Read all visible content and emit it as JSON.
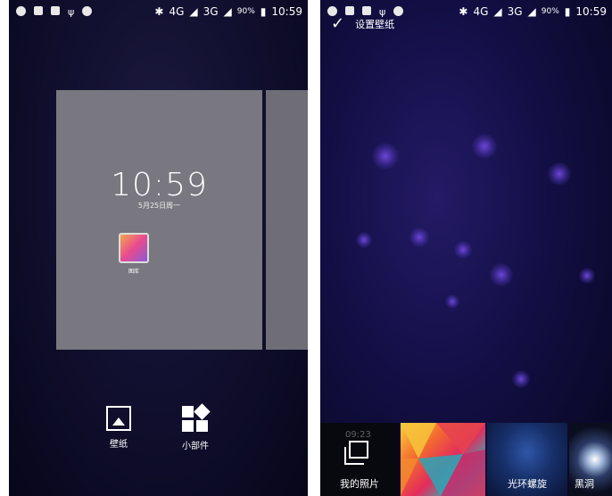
{
  "left_screen": {
    "status": {
      "network": "4G",
      "network2": "3G",
      "battery": "90%",
      "time": "10:59"
    },
    "home_preview": {
      "clock": "10:59",
      "date": "5月25日周一",
      "app_label": "图库"
    },
    "buttons": {
      "wallpaper": "壁纸",
      "widgets": "小部件"
    }
  },
  "right_screen": {
    "status": {
      "network": "4G",
      "network2": "3G",
      "battery": "90%",
      "time": "10:59"
    },
    "title": "设置壁纸",
    "thumbnails": [
      {
        "label": "我的照片"
      },
      {
        "label": ""
      },
      {
        "label": "光环螺旋"
      },
      {
        "label": "黑洞"
      }
    ],
    "faded_time": "09:23"
  },
  "colors": {
    "page_card": "#79777f",
    "background_dark": "#0b0a20",
    "particle": "#6b45d8"
  },
  "icons": [
    "sync-icon",
    "image-icon",
    "sim-icon",
    "usb-icon",
    "android-icon",
    "bluetooth-icon",
    "signal-icon",
    "battery-icon",
    "check-icon",
    "wallpaper-icon",
    "widgets-icon",
    "photos-icon"
  ]
}
